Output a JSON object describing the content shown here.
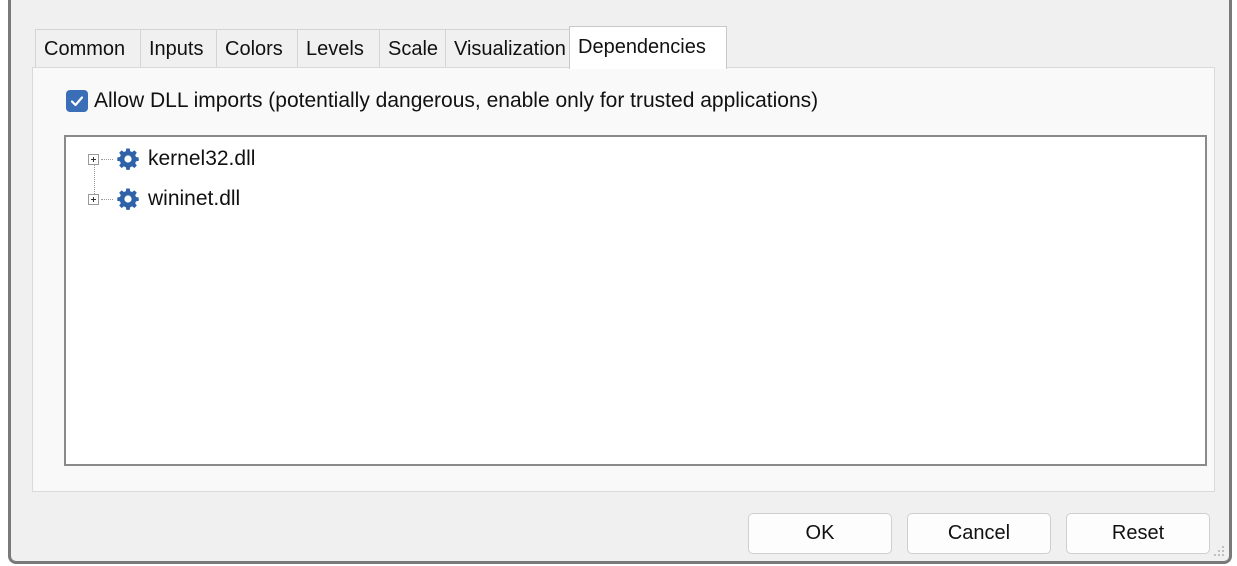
{
  "tabs": [
    {
      "label": "Common"
    },
    {
      "label": "Inputs"
    },
    {
      "label": "Colors"
    },
    {
      "label": "Levels"
    },
    {
      "label": "Scale"
    },
    {
      "label": "Visualization"
    },
    {
      "label": "Dependencies",
      "active": true
    }
  ],
  "dependencies": {
    "allow_dll_label": "Allow DLL imports (potentially dangerous, enable only for trusted applications)",
    "allow_dll_checked": true,
    "items": [
      {
        "label": "kernel32.dll",
        "icon": "gear-icon"
      },
      {
        "label": "wininet.dll",
        "icon": "gear-icon"
      }
    ]
  },
  "buttons": {
    "ok": "OK",
    "cancel": "Cancel",
    "reset": "Reset"
  },
  "colors": {
    "accent": "#3a6fb8",
    "gear": "#2f62a8"
  }
}
